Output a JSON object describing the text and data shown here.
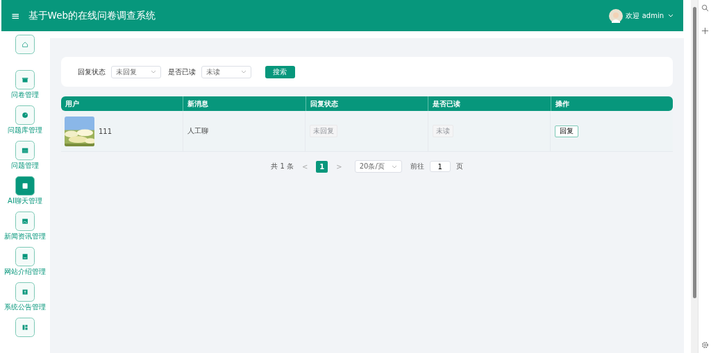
{
  "header": {
    "menu_icon": "≡",
    "title": "基于Web的在线问卷调查系统",
    "user": "欢迎 admin"
  },
  "sidebar": {
    "items": [
      {
        "selected": false
      },
      {
        "label": "问卷管理",
        "selected": false
      },
      {
        "label": "问题库管理",
        "selected": false
      },
      {
        "label": "问题管理",
        "selected": false
      },
      {
        "label": "AI聊天管理",
        "selected": true
      },
      {
        "label": "新闻资讯管理",
        "selected": false
      },
      {
        "label": "网站介绍管理",
        "selected": false
      },
      {
        "label": "系统公告管理",
        "selected": false
      },
      {
        "selected": false
      }
    ]
  },
  "filters": [
    {
      "label": "回复状态",
      "value": "未回复"
    },
    {
      "label": "是否已读",
      "value": "未读"
    }
  ],
  "search_button": "搜索",
  "table": {
    "columns": [
      "用户",
      "新消息",
      "回复状态",
      "是否已读",
      "操作"
    ],
    "rows": [
      {
        "user": "111",
        "message": "人工聊",
        "reply_status": "未回复",
        "read_status": "未读",
        "action": "回复"
      }
    ]
  },
  "pagination": {
    "total": "共 1 条",
    "prev": "<",
    "pages": [
      {
        "label": "1",
        "selected": true
      }
    ],
    "next": ">",
    "page_size": "20条/页",
    "goto_label": "前往",
    "goto_value": "1",
    "page_unit": "页"
  }
}
